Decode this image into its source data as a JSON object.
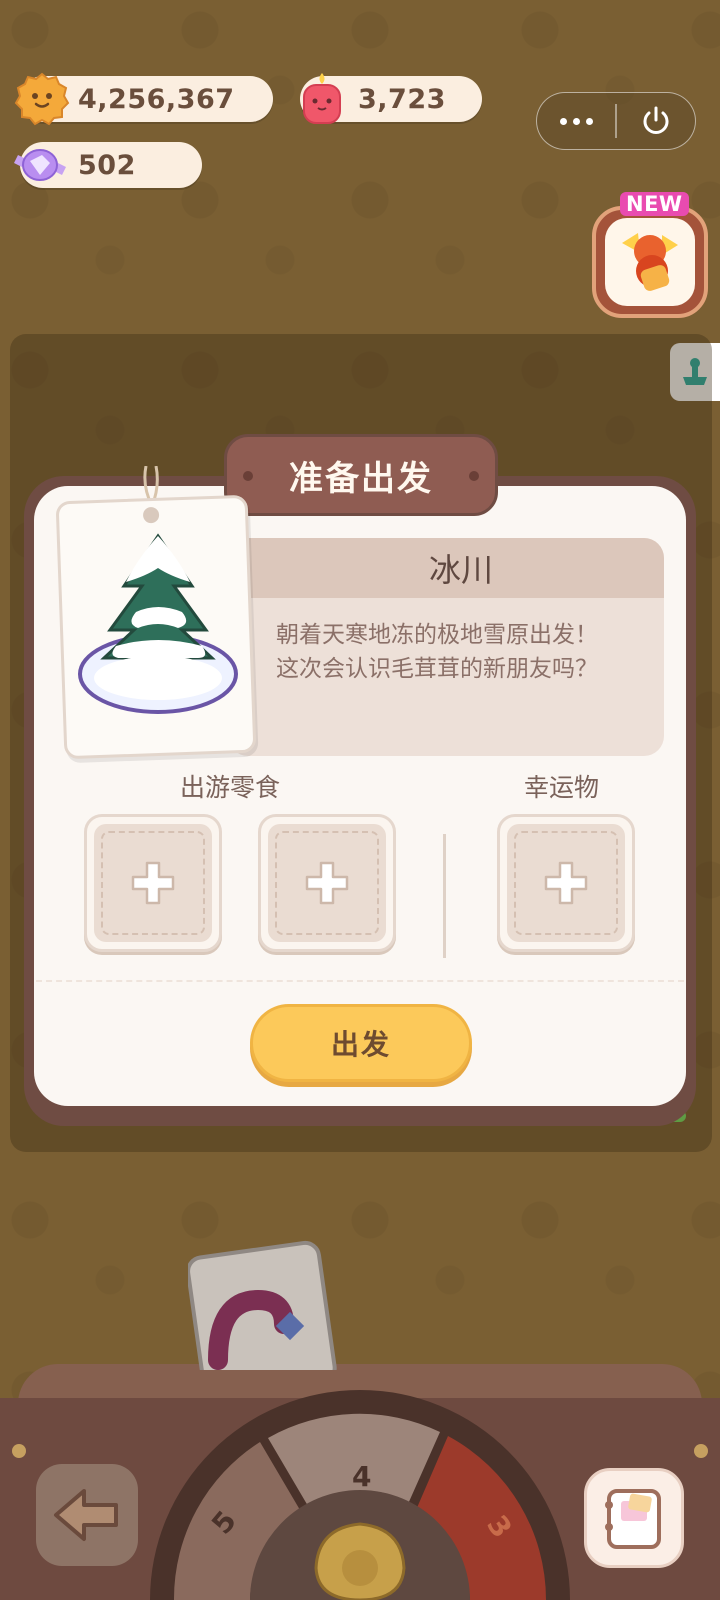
{
  "currencies": {
    "coins": "4,256,367",
    "candles": "3,723",
    "gems": "502"
  },
  "top_badge": {
    "label": "NEW"
  },
  "dialog": {
    "title": "准备出发",
    "destination_name": "冰川",
    "description_line1": "朝着天寒地冻的极地雪原出发！",
    "description_line2": "这次会认识毛茸茸的新朋友吗？",
    "snack_section_label": "出游零食",
    "lucky_item_section_label": "幸运物",
    "depart_button_label": "出发"
  },
  "dial": {
    "segments": [
      "5",
      "4",
      "3"
    ]
  },
  "colors": {
    "background": "#7a5f33",
    "dialog_border": "#6f4c43",
    "title_plaque": "#8f5c52",
    "depart_button": "#fcc95a",
    "dial_segment_3": "#9c3a2b"
  },
  "icons": {
    "coin": "cookie-coin-icon",
    "candle": "candle-icon",
    "gem": "crystal-candy-icon",
    "more": "more-dots-icon",
    "power": "power-icon",
    "event": "new-event-icon",
    "side": "trophy-icon",
    "slot": "plus-icon",
    "back": "back-arrow-icon",
    "book": "album-book-icon"
  }
}
